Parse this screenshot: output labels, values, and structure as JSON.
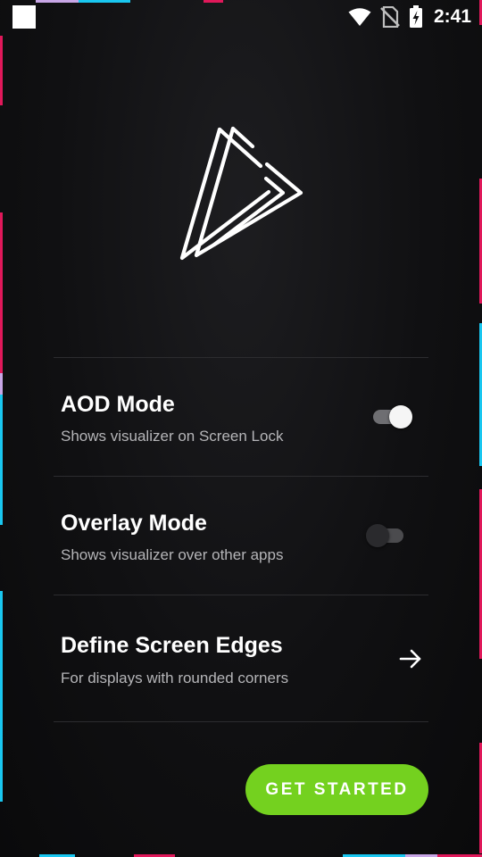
{
  "status_bar": {
    "time": "2:41",
    "icons": [
      "notification-square-icon",
      "wifi-icon",
      "no-sim-icon",
      "battery-charging-icon"
    ]
  },
  "settings": [
    {
      "title": "AOD Mode",
      "subtitle": "Shows visualizer on Screen Lock",
      "control": "toggle",
      "enabled": true
    },
    {
      "title": "Overlay Mode",
      "subtitle": "Shows visualizer over other apps",
      "control": "toggle",
      "enabled": false
    },
    {
      "title": "Define Screen Edges",
      "subtitle": "For displays with rounded corners",
      "control": "arrow-right-icon"
    }
  ],
  "cta": {
    "label": "GET STARTED"
  },
  "colors": {
    "background": "#101012",
    "accent": "#74d11f",
    "edge_pink": "#e0185a",
    "edge_cyan": "#19c7f0",
    "edge_lilac": "#c8a6e6"
  }
}
